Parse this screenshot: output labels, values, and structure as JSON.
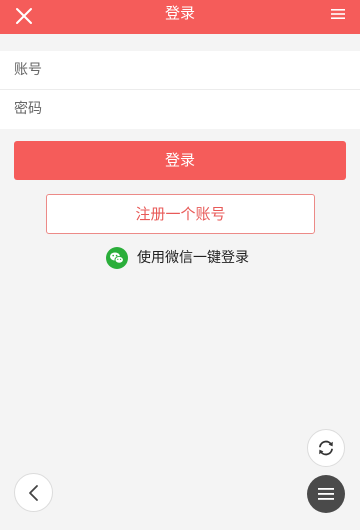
{
  "header": {
    "title": "登录",
    "close_icon": "close-icon",
    "menu_icon": "hamburger-menu-icon",
    "background": "#f55c5a"
  },
  "form": {
    "account_placeholder": "账号",
    "account_value": "",
    "password_placeholder": "密码",
    "password_value": ""
  },
  "buttons": {
    "login_label": "登录",
    "register_label": "注册一个账号",
    "wechat_label": "使用微信一键登录"
  },
  "icons": {
    "wechat": "wechat-icon",
    "refresh": "refresh-icon",
    "back": "chevron-left-icon",
    "menu": "menu-icon"
  },
  "colors": {
    "accent": "#f55c5a",
    "wechat_green": "#2aae3a",
    "page_background": "#f4f4f4"
  }
}
